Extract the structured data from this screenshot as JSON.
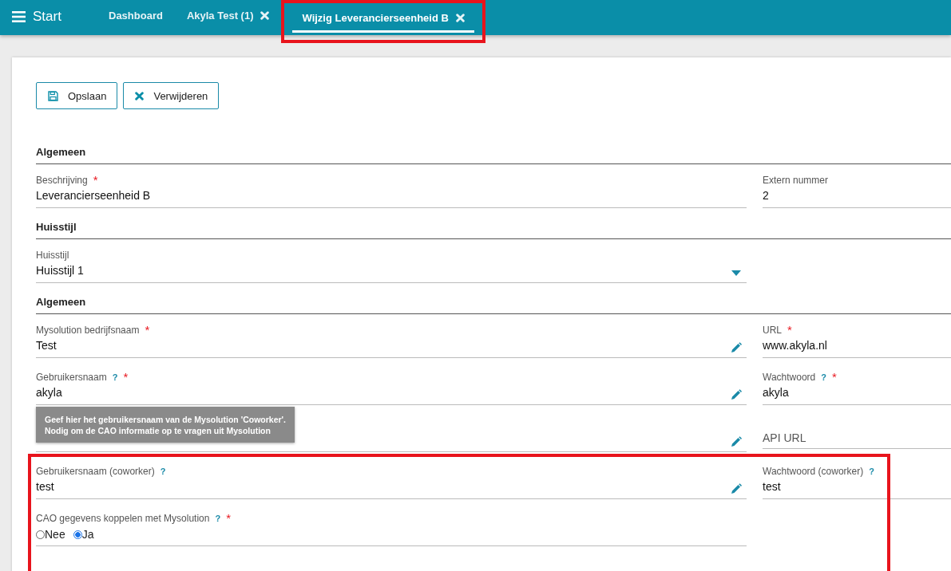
{
  "topbar": {
    "title": "Start",
    "tabs": [
      {
        "label": "Dashboard",
        "closable": false,
        "selected": false,
        "highlighted": false
      },
      {
        "label": "Akyla Test (1)",
        "closable": true,
        "selected": false,
        "highlighted": false
      },
      {
        "label": "Wijzig Leverancierseenheid B",
        "closable": true,
        "selected": true,
        "highlighted": true
      }
    ]
  },
  "toolbar": [
    {
      "label": "Opslaan",
      "kind": "save"
    },
    {
      "label": "Verwijderen",
      "kind": "delete"
    }
  ],
  "sections": [
    {
      "title": "Algemeen",
      "rows": [
        {
          "fields": [
            {
              "kind": "text",
              "label": "Beschrijving",
              "required_mark": "*",
              "value": "Leverancierseenheid B"
            },
            {
              "kind": "text",
              "label": "Extern nummer",
              "value": "2"
            }
          ]
        }
      ]
    },
    {
      "title": "Huisstijl",
      "rows": [
        {
          "fields": [
            {
              "kind": "select",
              "label": "Huisstijl",
              "value": "Huisstijl 1"
            }
          ]
        }
      ]
    },
    {
      "title": "Algemeen",
      "rows": [
        {
          "fields": [
            {
              "kind": "edit",
              "label": "Mysolution bedrijfsnaam",
              "required_mark": "*",
              "value": "Test"
            },
            {
              "kind": "text",
              "label": "URL",
              "required_mark": "*",
              "value": "www.akyla.nl"
            }
          ]
        },
        {
          "fields": [
            {
              "kind": "edit",
              "label": "Gebruikersnaam",
              "help_mark": "?",
              "required_mark": "*",
              "value": "akyla",
              "tooltip": [
                "Geef hier het gebruikersnaam van de Mysolution 'Coworker'.",
                "Nodig om de CAO informatie op te vragen uit Mysolution"
              ]
            },
            {
              "kind": "text",
              "label": "Wachtwoord",
              "help_mark": "?",
              "required_mark": "*",
              "value": "akyla"
            }
          ]
        },
        {
          "fields": [
            {
              "kind": "edit"
            },
            {
              "kind": "empty",
              "label": "API URL"
            }
          ]
        }
      ],
      "highlighted_rows": [
        {
          "fields": [
            {
              "kind": "edit",
              "label": "Gebruikersnaam (coworker)",
              "help_mark": "?",
              "value": "test"
            },
            {
              "kind": "text",
              "label": "Wachtwoord (coworker)",
              "help_mark": "?",
              "value": "test"
            }
          ]
        },
        {
          "fields": [
            {
              "kind": "radio",
              "label": "CAO gegevens koppelen met Mysolution",
              "help_mark": "?",
              "required_mark": "*",
              "options": [
                {
                  "label": "Nee",
                  "selected": false
                },
                {
                  "label": "Ja",
                  "selected": true
                }
              ]
            }
          ]
        }
      ]
    }
  ]
}
